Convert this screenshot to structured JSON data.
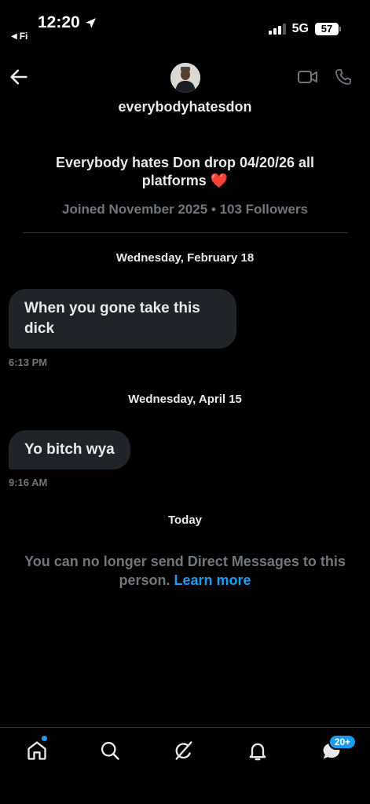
{
  "status_bar": {
    "time": "12:20",
    "back_app": "Fi",
    "network": "5G",
    "battery": "57"
  },
  "header": {
    "username": "everybodyhatesdon"
  },
  "profile": {
    "bio": "Everybody hates Don drop 04/20/26 all platforms ❤️",
    "joined": "Joined November 2025 • 103 Followers"
  },
  "conversation": {
    "groups": [
      {
        "date": "Wednesday, February 18",
        "message": "When you gone take this dick",
        "time": "6:13 PM"
      },
      {
        "date": "Wednesday, April 15",
        "message": "Yo bitch wya",
        "time": "9:16 AM"
      }
    ],
    "today_label": "Today",
    "notice": "You can no longer send Direct Messages to this person.",
    "notice_link": "Learn more"
  },
  "bottom_nav": {
    "items": [
      "home-icon",
      "search-icon",
      "grok-icon",
      "notifications-icon",
      "messages-icon"
    ],
    "messages_badge": "20+",
    "accent": "#1d9bf0"
  }
}
